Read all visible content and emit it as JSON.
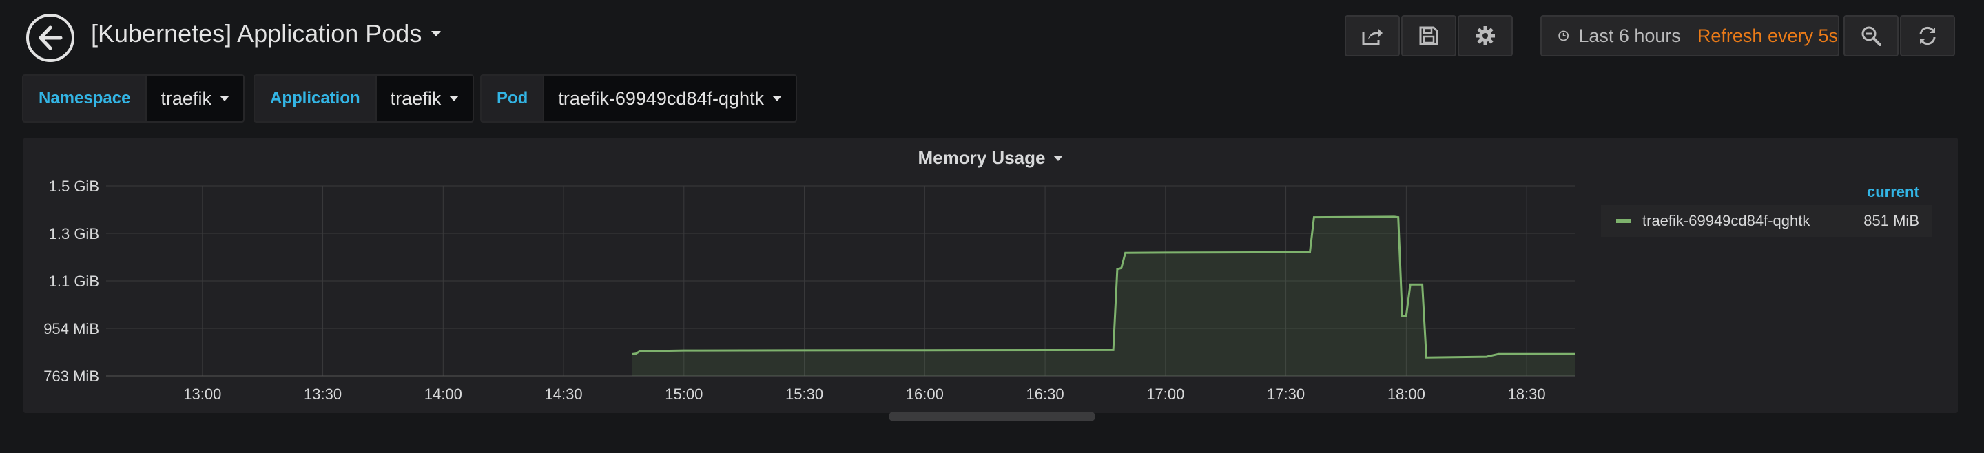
{
  "navbar": {
    "title": "[Kubernetes] Application Pods",
    "time_range": "Last 6 hours",
    "refresh": "Refresh every 5s"
  },
  "variables": [
    {
      "label": "Namespace",
      "value": "traefik"
    },
    {
      "label": "Application",
      "value": "traefik"
    },
    {
      "label": "Pod",
      "value": "traefik-69949cd84f-qghtk"
    }
  ],
  "panel": {
    "title": "Memory Usage",
    "legend_header": "current",
    "legend": [
      {
        "name": "traefik-69949cd84f-qghtk",
        "value": "851 MiB",
        "color": "#7eb26d"
      }
    ]
  },
  "icons": [
    "back-arrow-icon",
    "share-icon",
    "save-icon",
    "gear-icon",
    "clock-icon",
    "zoom-out-icon",
    "refresh-icon"
  ],
  "chart_data": {
    "type": "line",
    "title": "Memory Usage",
    "y_ticks": [
      "763 MiB",
      "954 MiB",
      "1.1 GiB",
      "1.3 GiB",
      "1.5 GiB"
    ],
    "x_ticks": [
      "13:00",
      "13:30",
      "14:00",
      "14:30",
      "15:00",
      "15:30",
      "16:00",
      "16:30",
      "17:00",
      "17:30",
      "18:00",
      "18:30"
    ],
    "ylim_mib": [
      763,
      1526
    ],
    "xlim": [
      "12:36",
      "18:42"
    ],
    "grid": true,
    "series": [
      {
        "name": "traefik-69949cd84f-qghtk",
        "color": "#7eb26d",
        "points": [
          [
            "14:47",
            850
          ],
          [
            "14:48",
            852
          ],
          [
            "14:49",
            862
          ],
          [
            "15:00",
            865
          ],
          [
            "16:00",
            866
          ],
          [
            "16:47",
            867
          ],
          [
            "16:48",
            1192
          ],
          [
            "16:49",
            1196
          ],
          [
            "16:50",
            1257
          ],
          [
            "17:00",
            1258
          ],
          [
            "17:36",
            1260
          ],
          [
            "17:37",
            1400
          ],
          [
            "17:57",
            1402
          ],
          [
            "17:58",
            1400
          ],
          [
            "17:59",
            1005
          ],
          [
            "18:00",
            1005
          ],
          [
            "18:01",
            1130
          ],
          [
            "18:04",
            1130
          ],
          [
            "18:05",
            837
          ],
          [
            "18:20",
            840
          ],
          [
            "18:23",
            851
          ],
          [
            "18:42",
            851
          ]
        ]
      }
    ]
  }
}
